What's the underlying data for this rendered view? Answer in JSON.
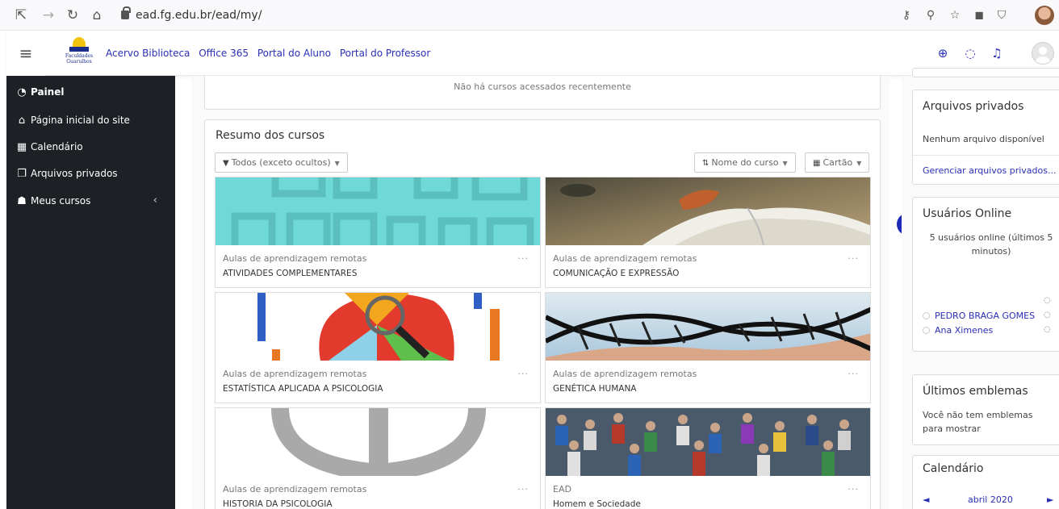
{
  "browser": {
    "url": "ead.fg.edu.br/ead/my/"
  },
  "navbar": {
    "logo_text": "Faculdades Guarulhos",
    "links": [
      "Acervo Biblioteca",
      "Office 365",
      "Portal do Aluno",
      "Portal do Professor"
    ]
  },
  "drawer": {
    "items": [
      {
        "label": "Painel",
        "icon": "dashboard-icon"
      },
      {
        "label": "Página inicial do site",
        "icon": "home-icon"
      },
      {
        "label": "Calendário",
        "icon": "calendar-icon"
      },
      {
        "label": "Arquivos privados",
        "icon": "files-icon"
      },
      {
        "label": "Meus cursos",
        "icon": "graduation-cap-icon"
      }
    ]
  },
  "main": {
    "recent_empty": "Não há cursos acessados recentemente",
    "summary_title": "Resumo dos cursos",
    "filter": {
      "label": "Todos (exceto ocultos)"
    },
    "sort": {
      "label": "Nome do curso"
    },
    "view": {
      "label": "Cartão"
    },
    "courses": [
      {
        "category": "Aulas de aprendizagem remotas",
        "name": "ATIVIDADES COMPLEMENTARES"
      },
      {
        "category": "Aulas de aprendizagem remotas",
        "name": "COMUNICAÇÃO E EXPRESSÃO"
      },
      {
        "category": "Aulas de aprendizagem remotas",
        "name": "ESTATÍSTICA APLICADA A PSICOLOGIA"
      },
      {
        "category": "Aulas de aprendizagem remotas",
        "name": "GENÉTICA HUMANA"
      },
      {
        "category": "Aulas de aprendizagem remotas",
        "name": "HISTORIA DA PSICOLOGIA"
      },
      {
        "category": "EAD",
        "name": "Homem e Sociedade"
      }
    ],
    "course_menu": "···"
  },
  "blocks": {
    "private_files": {
      "title": "Arquivos privados",
      "empty": "Nenhum arquivo disponível",
      "manage_link": "Gerenciar arquivos privados..."
    },
    "online_users": {
      "title": "Usuários Online",
      "summary": "5 usuários online (últimos 5 minutos)",
      "users": [
        "PEDRO BRAGA GOMES",
        "Ana Ximenes"
      ]
    },
    "badges": {
      "title": "Últimos emblemas",
      "empty": "Você não tem emblemas para mostrar"
    },
    "calendar": {
      "title": "Calendário",
      "month": "abril 2020",
      "prev": "◄",
      "next": "►"
    }
  }
}
